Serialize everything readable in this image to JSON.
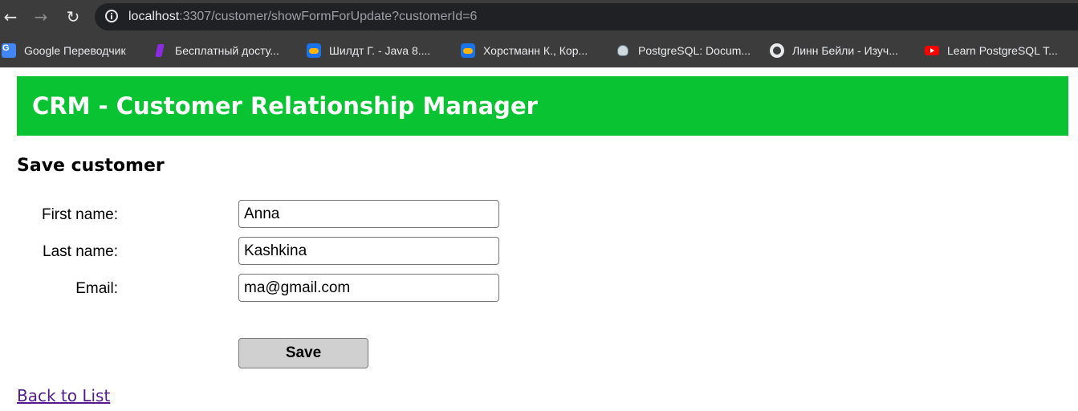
{
  "browser": {
    "url_host": "localhost",
    "url_path": ":3307/customer/showFormForUpdate?customerId=6",
    "bookmarks": [
      {
        "label": "Google Переводчик",
        "icon": "google-translate-icon"
      },
      {
        "label": "Бесплатный досту...",
        "icon": "bookmark-purple-icon"
      },
      {
        "label": "Шилдт Г. - Java 8....",
        "icon": "cloud-icon"
      },
      {
        "label": "Хорстманн К., Кор...",
        "icon": "cloud-icon"
      },
      {
        "label": "PostgreSQL: Docum...",
        "icon": "postgresql-icon"
      },
      {
        "label": "Линн Бейли - Изуч...",
        "icon": "globe-icon"
      },
      {
        "label": "Learn PostgreSQL T...",
        "icon": "youtube-icon"
      }
    ]
  },
  "page": {
    "header_title": "CRM - Customer Relationship Manager",
    "section_title": "Save customer",
    "form": {
      "first_name_label": "First name:",
      "first_name_value": "Anna",
      "last_name_label": "Last name:",
      "last_name_value": "Kashkina",
      "email_label": "Email:",
      "email_value": "ma@gmail.com",
      "save_label": "Save"
    },
    "back_link": "Back to List"
  },
  "colors": {
    "header_bg": "#09c332",
    "link": "#551a8b"
  }
}
